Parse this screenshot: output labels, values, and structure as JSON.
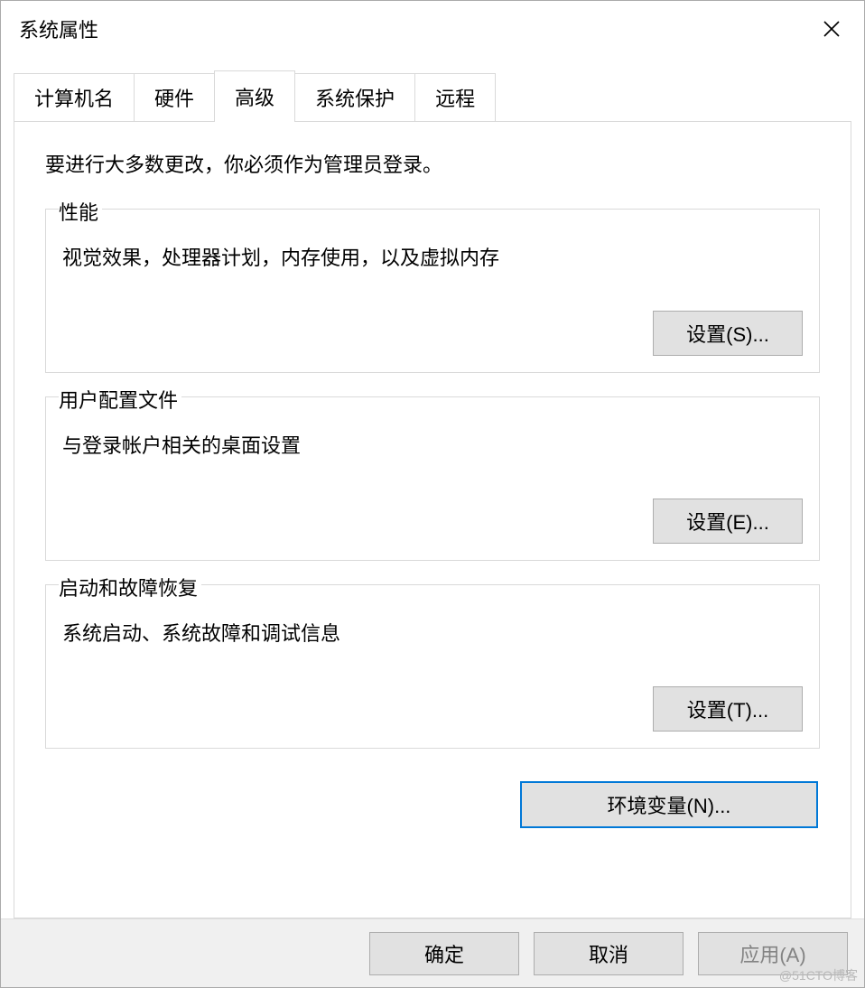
{
  "window": {
    "title": "系统属性"
  },
  "tabs": [
    {
      "label": "计算机名",
      "active": false
    },
    {
      "label": "硬件",
      "active": false
    },
    {
      "label": "高级",
      "active": true
    },
    {
      "label": "系统保护",
      "active": false
    },
    {
      "label": "远程",
      "active": false
    }
  ],
  "panel": {
    "admin_note": "要进行大多数更改，你必须作为管理员登录。",
    "performance": {
      "title": "性能",
      "desc": "视觉效果，处理器计划，内存使用，以及虚拟内存",
      "button": "设置(S)..."
    },
    "user_profiles": {
      "title": "用户配置文件",
      "desc": "与登录帐户相关的桌面设置",
      "button": "设置(E)..."
    },
    "startup_recovery": {
      "title": "启动和故障恢复",
      "desc": "系统启动、系统故障和调试信息",
      "button": "设置(T)..."
    },
    "env_button": "环境变量(N)..."
  },
  "buttons": {
    "ok": "确定",
    "cancel": "取消",
    "apply": "应用(A)"
  },
  "watermark": "@51CTO博客"
}
